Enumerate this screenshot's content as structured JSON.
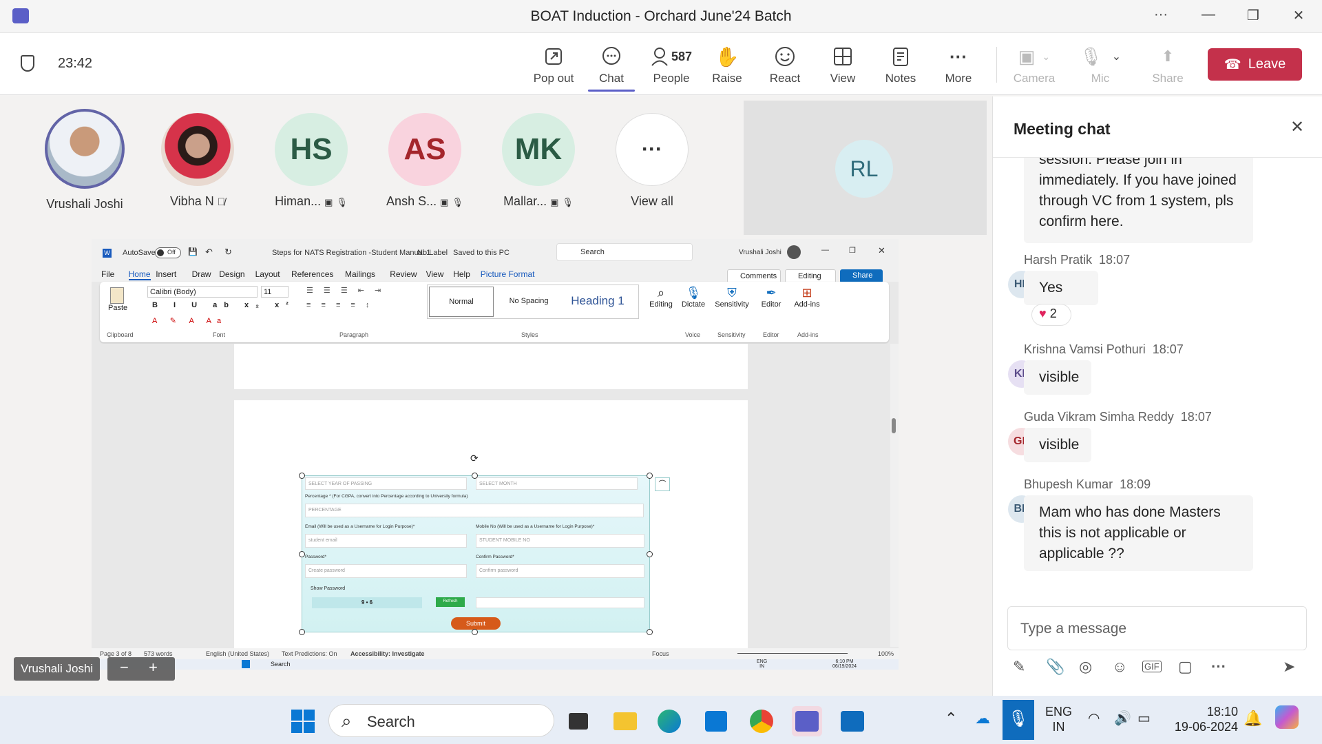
{
  "window": {
    "title": "BOAT Induction - Orchard June'24 Batch"
  },
  "toolbar": {
    "timer": "23:42",
    "popout": "Pop out",
    "chat": "Chat",
    "people_count": "587",
    "people": "People",
    "raise": "Raise",
    "react": "React",
    "view": "View",
    "notes": "Notes",
    "more": "More",
    "camera": "Camera",
    "mic": "Mic",
    "share": "Share",
    "leave": "Leave"
  },
  "participants": [
    {
      "name": "Vrushali Joshi",
      "initials": ""
    },
    {
      "name": "Vibha N",
      "initials": ""
    },
    {
      "name": "Himan...",
      "initials": "HS"
    },
    {
      "name": "Ansh S...",
      "initials": "AS"
    },
    {
      "name": "Mallar...",
      "initials": "MK"
    },
    {
      "name": "View all",
      "initials": ""
    }
  ],
  "rl_tile": {
    "initials": "RL"
  },
  "presenter_label": "Vrushali Joshi",
  "word": {
    "autosave": "AutoSave",
    "autosave_state": "Off",
    "doc_title": "Steps for NATS Registration -Student Manual 1",
    "label": "No Label",
    "saved": "Saved to this PC",
    "search": "Search",
    "user": "Vrushali Joshi",
    "tabs": [
      "File",
      "Home",
      "Insert",
      "Draw",
      "Design",
      "Layout",
      "References",
      "Mailings",
      "Review",
      "View",
      "Help",
      "Picture Format"
    ],
    "comments": "Comments",
    "editing_btn": "Editing",
    "share_btn": "Share",
    "font_name": "Calibri (Body)",
    "font_size": "11",
    "paste": "Paste",
    "groups": {
      "clipboard": "Clipboard",
      "font": "Font",
      "paragraph": "Paragraph",
      "styles": "Styles",
      "voice": "Voice",
      "sensitivity": "Sensitivity",
      "editor": "Editor",
      "addins": "Add-ins"
    },
    "styles": [
      "Normal",
      "No Spacing",
      "Heading 1"
    ],
    "ribbon_buttons": {
      "editing": "Editing",
      "dictate": "Dictate",
      "sensitivity": "Sensitivity",
      "editor": "Editor",
      "addins": "Add-ins"
    },
    "status": {
      "page": "Page 3 of 8",
      "words": "573 words",
      "lang": "English (United States)",
      "predictions": "Text Predictions: On",
      "accessibility": "Accessibility: Investigate",
      "focus": "Focus",
      "zoom": "100%"
    },
    "inner_taskbar": {
      "search": "Search",
      "lang1": "ENG",
      "lang2": "IN",
      "time": "6:10 PM",
      "date": "06/19/2024"
    }
  },
  "form": {
    "year": "SELECT YEAR OF PASSING",
    "month": "SELECT MONTH",
    "percent_label": "Percentage * (For CGPA, convert into Percentage according to University formula)",
    "percent_ph": "PERCENTAGE",
    "email_label": "Email (Will be used as a Username for Login Purpose)*",
    "email_ph": "student email",
    "mobile_label": "Mobile No (Will be used as a Username for Login Purpose)*",
    "mobile_ph": "STUDENT MOBILE NO",
    "password_label": "Password*",
    "password_ph": "Create password",
    "confirm_label": "Confirm Password*",
    "confirm_ph": "Confirm password",
    "show_password": "Show Password",
    "captcha": "9 • 6",
    "refresh": "Refresh",
    "submit": "Submit"
  },
  "chat": {
    "title": "Meeting chat",
    "first_bubble": "session. Please join in immediately. If you have joined through VC from 1 system, pls confirm here.",
    "messages": [
      {
        "name": "Harsh Pratik",
        "time": "18:07",
        "initials": "HP",
        "text": "Yes"
      },
      {
        "name": "Krishna Vamsi Pothuri",
        "time": "18:07",
        "initials": "KP",
        "text": "visible"
      },
      {
        "name": "Guda Vikram Simha Reddy",
        "time": "18:07",
        "initials": "GR",
        "text": "visible"
      },
      {
        "name": "Bhupesh Kumar",
        "time": "18:09",
        "initials": "BK",
        "text": "Mam who has done Masters this is not applicable or applicable ??"
      }
    ],
    "reaction_count": "2",
    "compose_placeholder": "Type a message"
  },
  "taskbar": {
    "search": "Search",
    "lang1": "ENG",
    "lang2": "IN",
    "time": "18:10",
    "date": "19-06-2024"
  },
  "colors": {
    "accent": "#5b5fc7",
    "leave": "#c4314b",
    "mic_active": "#0f6cbd"
  }
}
